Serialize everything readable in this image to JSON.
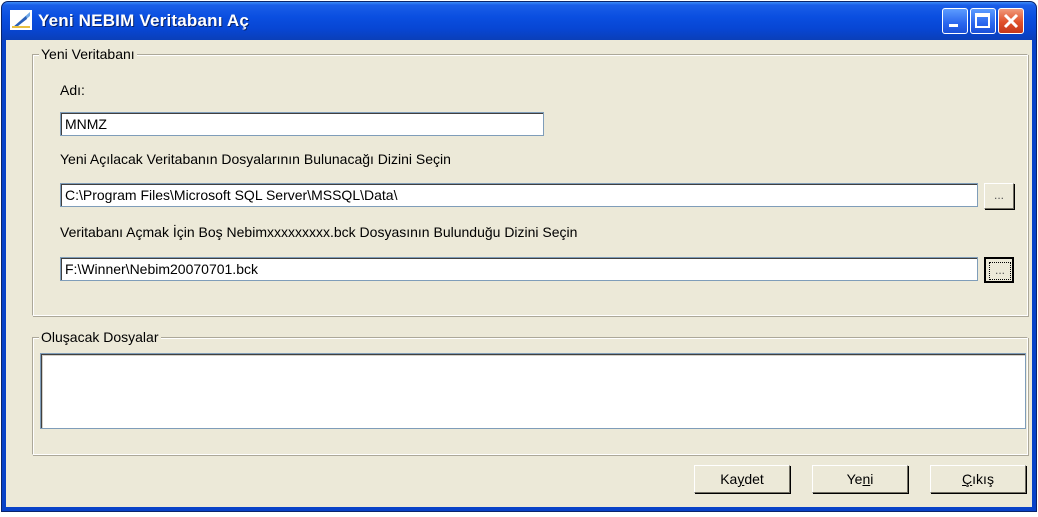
{
  "window": {
    "title": "Yeni NEBIM Veritabanı Aç",
    "controls": {
      "minimize": "minimize-icon",
      "maximize": "maximize-icon",
      "close": "close-icon"
    }
  },
  "group_new_db": {
    "legend": "Yeni Veritabanı",
    "name_label": "Adı:",
    "name_value": "MNMZ",
    "dir_label": "Yeni Açılacak Veritabanın Dosyalarının Bulunacağı Dizini Seçin",
    "dir_value": "C:\\Program Files\\Microsoft SQL Server\\MSSQL\\Data\\",
    "dir_browse_label": "...",
    "bck_label": "Veritabanı Açmak İçin Boş Nebimxxxxxxxxx.bck Dosyasının Bulunduğu Dizini Seçin",
    "bck_value": "F:\\Winner\\Nebim20070701.bck",
    "bck_browse_label": "..."
  },
  "group_files": {
    "legend": "Oluşacak Dosyalar"
  },
  "buttons": {
    "save": {
      "pre": "Ka",
      "accel": "y",
      "post": "det"
    },
    "new": {
      "pre": "Ye",
      "accel": "n",
      "post": "i"
    },
    "exit": {
      "pre": "",
      "accel": "Ç",
      "post": "ıkış"
    }
  },
  "colors": {
    "titlebar": "#0a4ee0",
    "window_face": "#ece9d8",
    "close_button": "#e0502a"
  }
}
